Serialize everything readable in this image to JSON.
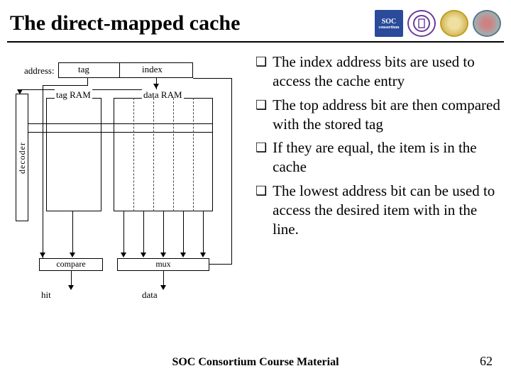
{
  "title": "The direct-mapped cache",
  "logos": {
    "soc_top": "SOC",
    "soc_bottom": "consortium",
    "purple": "purple-seal",
    "yellow": "yellow-seal",
    "teal": "teal-seal"
  },
  "diagram": {
    "address_label": "address:",
    "tag_label": "tag",
    "index_label": "index",
    "decoder_label": "decoder",
    "tag_ram_label": "tag RAM",
    "data_ram_label": "data RAM",
    "compare_label": "compare",
    "mux_label": "mux",
    "hit_label": "hit",
    "data_label": "data"
  },
  "bullets": [
    "The index address bits are used to access the cache entry",
    "The top address bit are then compared with the stored tag",
    "If they are equal, the item is in the cache",
    "The lowest address bit can be used to access the desired item with in the line."
  ],
  "footer": "SOC Consortium Course Material",
  "page_number": "62"
}
